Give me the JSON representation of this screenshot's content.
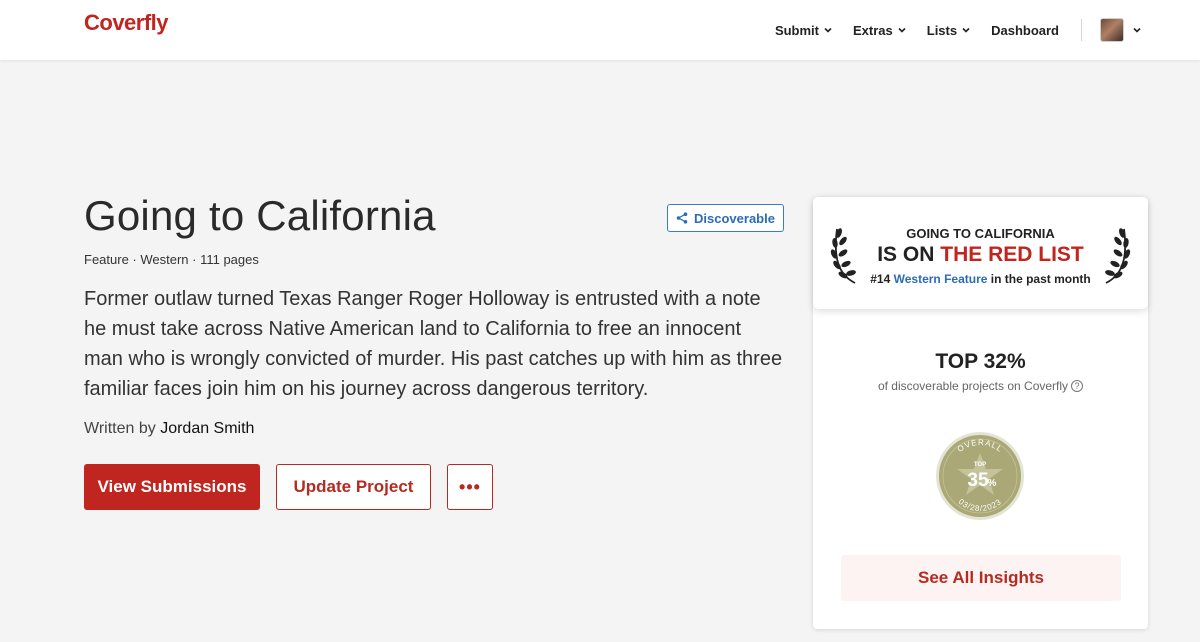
{
  "header": {
    "logo": "Coverfly",
    "nav": [
      {
        "label": "Submit",
        "has_dropdown": true
      },
      {
        "label": "Extras",
        "has_dropdown": true
      },
      {
        "label": "Lists",
        "has_dropdown": true
      },
      {
        "label": "Dashboard",
        "has_dropdown": false
      }
    ]
  },
  "project": {
    "title": "Going to California",
    "discoverable_label": "Discoverable",
    "meta": "Feature · Western · 111 pages",
    "logline": "Former outlaw turned Texas Ranger Roger Holloway is entrusted with a note he must take across Native American land to California to free an innocent man who is wrongly convicted of murder. His past catches up with him as three familiar faces join him on his journey across dangerous territory.",
    "written_by_prefix": "Written by",
    "author": "Jordan Smith",
    "buttons": {
      "view_submissions": "View Submissions",
      "update_project": "Update Project",
      "more": "•••"
    }
  },
  "sidebar": {
    "redlist": {
      "project_name": "GOING TO CALIFORNIA",
      "is_on": "IS ON",
      "list_name": "THE RED LIST",
      "rank": "#14",
      "category": "Western Feature",
      "period": "in the past month"
    },
    "top_percent": "TOP 32%",
    "top_percent_sub": "of discoverable projects on Coverfly",
    "badge": {
      "arc_top": "OVERALL",
      "label": "TOP",
      "value": "35",
      "unit": "%",
      "date": "03/28/2023"
    },
    "insights_label": "See All Insights"
  },
  "colors": {
    "brand_red": "#c0261f",
    "link_blue": "#2b6cb7",
    "badge_green": "#a9a876"
  }
}
